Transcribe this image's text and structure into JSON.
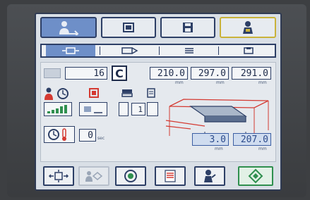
{
  "tabs": [
    {
      "name": "operator-tab",
      "icon": "operator-icon",
      "active": true
    },
    {
      "name": "copy-tab",
      "icon": "copy-icon",
      "active": false
    },
    {
      "name": "save-tab",
      "icon": "floppy-disk-icon",
      "active": false
    },
    {
      "name": "service-tab",
      "icon": "service-person-icon",
      "active": false
    }
  ],
  "subtabs": [
    {
      "icon": "paper-feed-icon",
      "active": true
    },
    {
      "icon": "output-tray-icon",
      "active": false
    },
    {
      "icon": "stack-icon",
      "active": false
    },
    {
      "icon": "cassette-icon",
      "active": false
    }
  ],
  "counter": {
    "value": "16",
    "mode_letter": "C"
  },
  "dimensions": {
    "width": {
      "value": "210.0",
      "unit": "mm"
    },
    "length": {
      "value": "297.0",
      "unit": "mm"
    },
    "height": {
      "value": "291.0",
      "unit": "mm"
    }
  },
  "timer": {
    "value": "0",
    "unit": "sec"
  },
  "small_field": {
    "value": "1"
  },
  "offsets": {
    "offset_a": {
      "value": "3.0",
      "unit": "mm"
    },
    "offset_b": {
      "value": "207.0",
      "unit": "mm"
    }
  },
  "bottom_buttons": [
    {
      "name": "position-button",
      "icon": "crosshair-arrows-icon"
    },
    {
      "name": "align-button",
      "icon": "operator-align-icon",
      "disabled": true
    },
    {
      "name": "target-button",
      "icon": "target-icon"
    },
    {
      "name": "list-button",
      "icon": "list-red-icon"
    },
    {
      "name": "help-button",
      "icon": "person-hand-icon"
    },
    {
      "name": "start-button",
      "icon": "start-diamond-icon"
    }
  ],
  "colors": {
    "accent": "#6e8fc8",
    "red": "#d43a32",
    "green": "#2f8f4e",
    "navy": "#2d3f66"
  }
}
